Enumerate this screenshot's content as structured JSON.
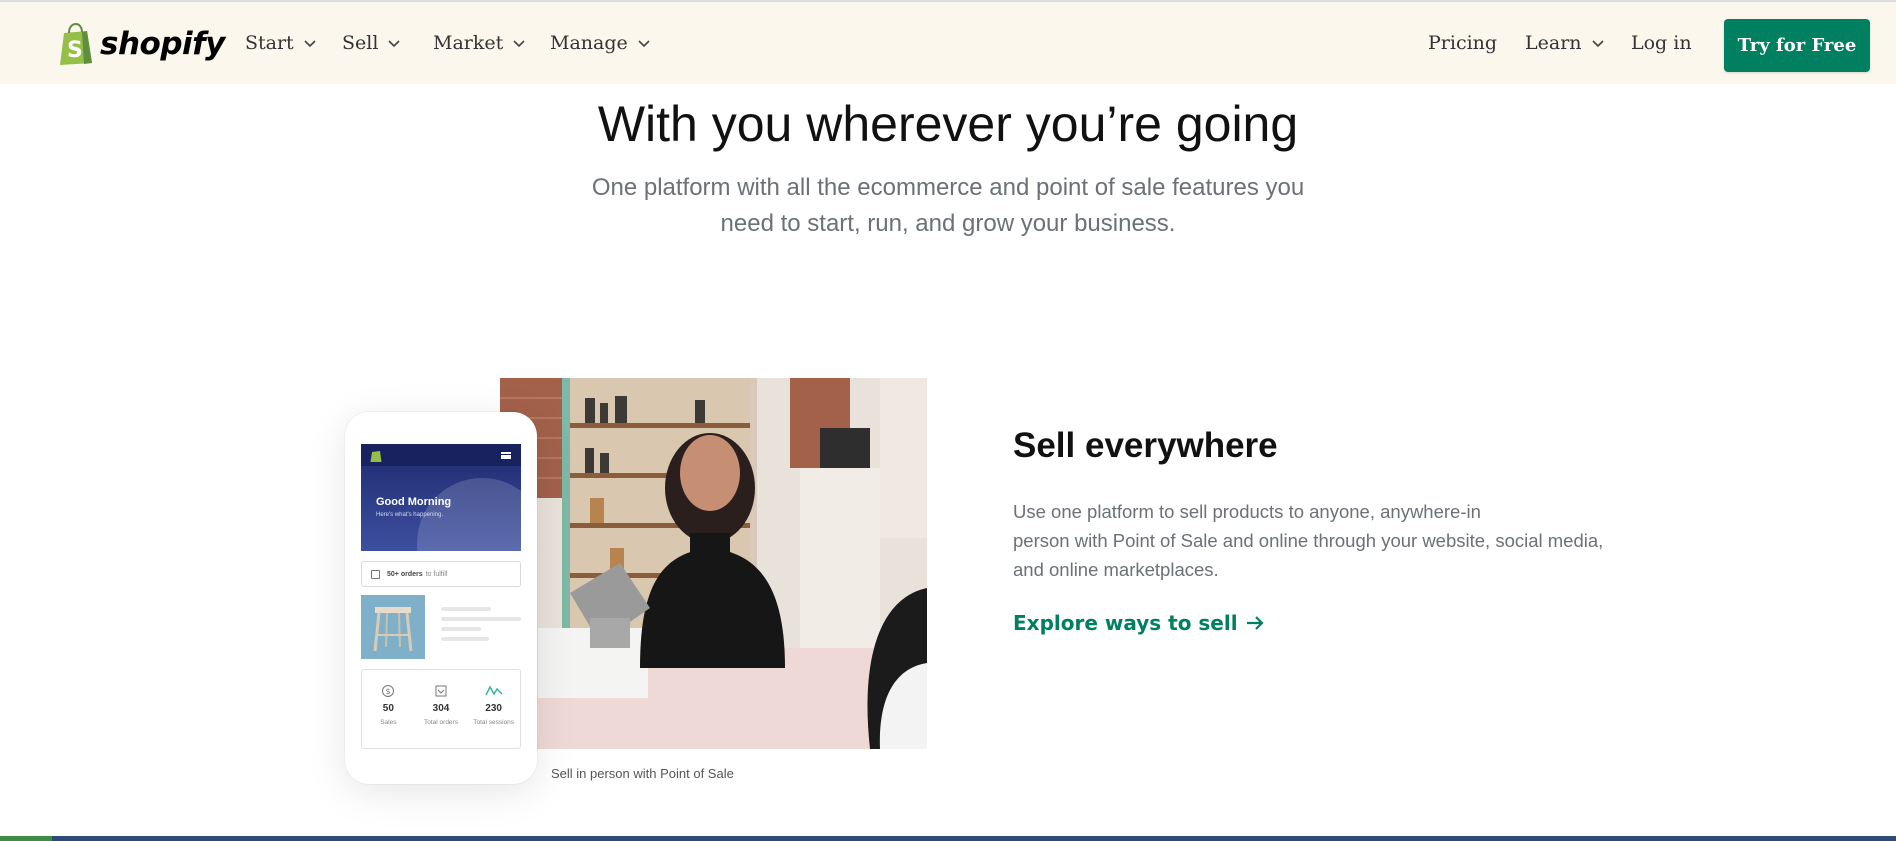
{
  "header": {
    "logo_text": "shopify",
    "nav_left": [
      {
        "label": "Start",
        "has_dropdown": true
      },
      {
        "label": "Sell",
        "has_dropdown": true
      },
      {
        "label": "Market",
        "has_dropdown": true
      },
      {
        "label": "Manage",
        "has_dropdown": true
      }
    ],
    "pricing_label": "Pricing",
    "learn_label": "Learn",
    "login_label": "Log in",
    "cta_label": "Try for Free"
  },
  "hero": {
    "title": "With you wherever you’re going",
    "subtitle": "One platform with all the ecommerce and point of sale features you need to start, run, and grow your business."
  },
  "feature": {
    "title": "Sell everywhere",
    "body_line1": "Use one platform to sell products to anyone, anywhere-in",
    "body_line2": "person with Point of Sale and online through your website, social media,",
    "body_line3": "and online marketplaces.",
    "link_label": "Explore ways to sell",
    "photo_caption": "Sell in person with Point of Sale",
    "phone": {
      "greeting": "Good Morning",
      "greeting_sub": "Here's what's happening.",
      "orders_count": "50+ orders",
      "orders_suffix": "to fulfill",
      "stats": [
        {
          "icon": "dollar-icon",
          "value": "50",
          "label": "Sales"
        },
        {
          "icon": "orders-icon",
          "value": "304",
          "label": "Total orders"
        },
        {
          "icon": "sessions-icon",
          "value": "230",
          "label": "Total sessions"
        }
      ]
    }
  },
  "colors": {
    "header_bg": "#fbf7ed",
    "brand_green": "#008060",
    "text_muted": "#6b7177"
  }
}
